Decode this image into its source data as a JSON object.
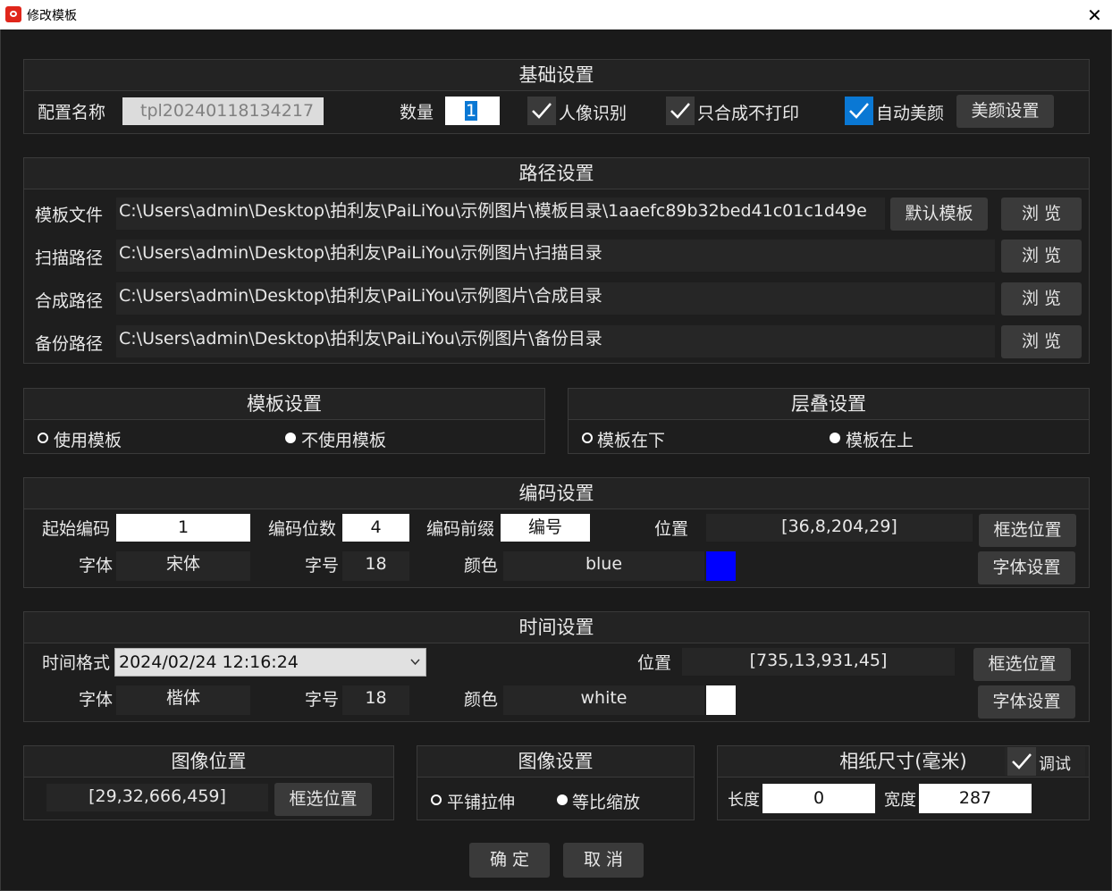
{
  "window": {
    "title": "修改模板",
    "close_glyph": "✕"
  },
  "basic": {
    "title": "基础设置",
    "config_name_label": "配置名称",
    "config_name_value": "tpl20240118134217",
    "quantity_label": "数量",
    "quantity_value": "1",
    "face_recognition_label": "人像识别",
    "compose_no_print_label": "只合成不打印",
    "auto_beauty_label": "自动美颜",
    "beauty_settings_button": "美颜设置"
  },
  "paths": {
    "title": "路径设置",
    "template_file_label": "模板文件",
    "template_file_value": "C:\\Users\\admin\\Desktop\\拍利友\\PaiLiYou\\示例图片\\模板目录\\1aaefc89b32bed41c01c1d49e",
    "default_template_button": "默认模板",
    "scan_label": "扫描路径",
    "scan_value": "C:\\Users\\admin\\Desktop\\拍利友\\PaiLiYou\\示例图片\\扫描目录",
    "compose_label": "合成路径",
    "compose_value": "C:\\Users\\admin\\Desktop\\拍利友\\PaiLiYou\\示例图片\\合成目录",
    "backup_label": "备份路径",
    "backup_value": "C:\\Users\\admin\\Desktop\\拍利友\\PaiLiYou\\示例图片\\备份目录",
    "browse_button": "浏 览"
  },
  "template_settings": {
    "title": "模板设置",
    "use_label": "使用模板",
    "no_use_label": "不使用模板"
  },
  "layer_settings": {
    "title": "层叠设置",
    "below_label": "模板在下",
    "above_label": "模板在上"
  },
  "encoding": {
    "title": "编码设置",
    "start_label": "起始编码",
    "start_value": "1",
    "digits_label": "编码位数",
    "digits_value": "4",
    "prefix_label": "编码前缀",
    "prefix_value": "编号",
    "position_label": "位置",
    "position_value": "[36,8,204,29]",
    "select_position_button": "框选位置",
    "font_label": "字体",
    "font_value": "宋体",
    "size_label": "字号",
    "size_value": "18",
    "color_label": "颜色",
    "color_value": "blue",
    "swatch_color": "#0000ff",
    "font_settings_button": "字体设置"
  },
  "time": {
    "title": "时间设置",
    "format_label": "时间格式",
    "format_value": "2024/02/24 12:16:24",
    "position_label": "位置",
    "position_value": "[735,13,931,45]",
    "select_position_button": "框选位置",
    "font_label": "字体",
    "font_value": "楷体",
    "size_label": "字号",
    "size_value": "18",
    "color_label": "颜色",
    "color_value": "white",
    "swatch_color": "#ffffff",
    "font_settings_button": "字体设置"
  },
  "image_position": {
    "title": "图像位置",
    "value": "[29,32,666,459]",
    "select_position_button": "框选位置"
  },
  "image_settings": {
    "title": "图像设置",
    "tile_label": "平铺拉伸",
    "scale_label": "等比缩放"
  },
  "paper": {
    "title": "相纸尺寸(毫米)",
    "debug_label": "调试",
    "length_label": "长度",
    "length_value": "0",
    "width_label": "宽度",
    "width_value": "287"
  },
  "footer": {
    "ok_button": "确 定",
    "cancel_button": "取 消"
  },
  "colors": {
    "accent": "#0a78d4",
    "background": "#1a1a1a",
    "panel": "#1e1e1e",
    "button": "#3a3a3a"
  }
}
